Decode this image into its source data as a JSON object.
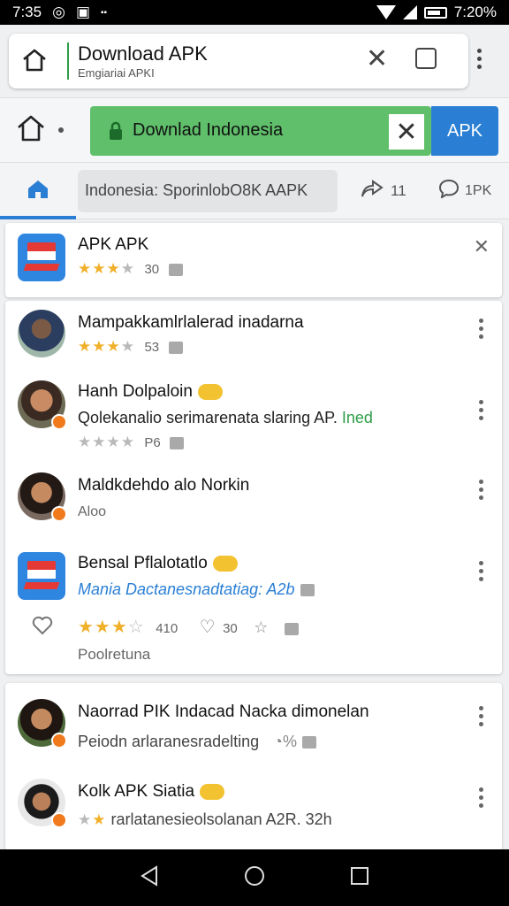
{
  "status_bar": {
    "time_left": "7:35",
    "time_right": "7:20%"
  },
  "url_card": {
    "title": "Download APK",
    "subtitle": "Emgiariai APKI",
    "tab_count": ""
  },
  "toolbar": {
    "green_text": "Downlad Indonesia",
    "apk_button": "APK"
  },
  "tabs_row": {
    "search_text": "Indonesia: SporinlobO8K AAPK",
    "share_count": "11",
    "chat_label": "1PK"
  },
  "top_card": {
    "title": "APK APK",
    "rating_text": "30"
  },
  "list_card": {
    "items": [
      {
        "title": "Mampakkamlrlalerad inadarna",
        "rating_text": "53"
      },
      {
        "title": "Hanh Dolpaloin",
        "desc_text": "Qolekanalio serimarenata slaring AP.",
        "desc_accent": "Ined",
        "rating_text": "P6"
      },
      {
        "title": "Maldkdehdo alo Norkin",
        "sub": "Aloo"
      },
      {
        "title": "Bensal Pflalotatlo",
        "link_text": "Mania Dactanesnadtatiag: A2b",
        "rating_text": "410",
        "likes": "30",
        "footer": "Poolretuna"
      }
    ]
  },
  "bottom_card": {
    "items": [
      {
        "title": "Naorrad PIK Indacad Nacka dimonelan",
        "sub": "Peiodn arlaranesradelting",
        "pct": "%"
      },
      {
        "title": "Kolk APK Siatia",
        "sub": "rarlatanesieolsolanan A2R. 32h"
      }
    ]
  },
  "colors": {
    "accent": "#2a7fd4",
    "green": "#5fbf6a",
    "star": "#f0b02a"
  },
  "icons": [
    "home-icon",
    "close-icon",
    "tab-switcher-icon",
    "menu-icon",
    "lock-icon",
    "share-icon",
    "chat-icon",
    "star-icon",
    "thumb-icon",
    "heart-icon",
    "back-icon",
    "home-nav-icon",
    "recents-icon"
  ]
}
